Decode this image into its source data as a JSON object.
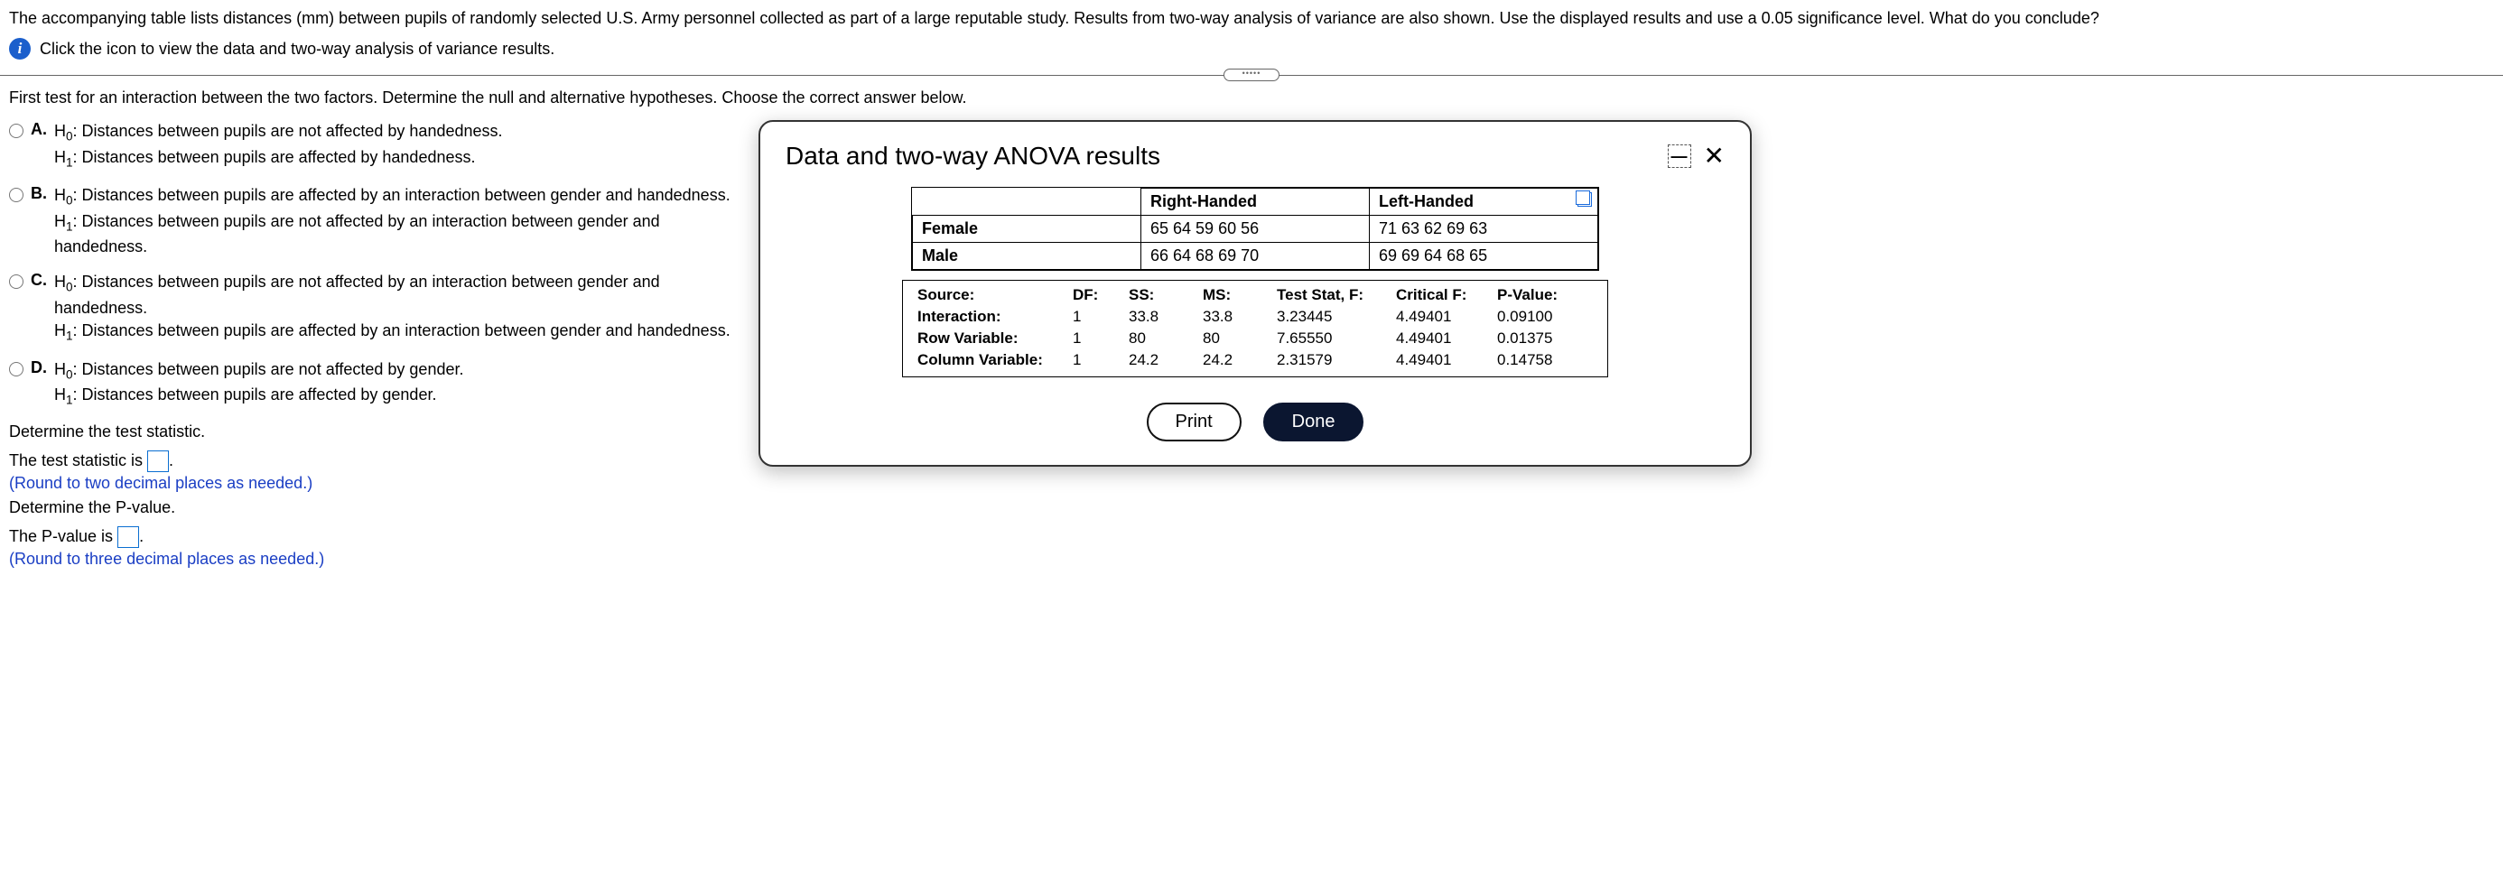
{
  "intro": "The accompanying table lists distances (mm) between pupils of randomly selected U.S. Army personnel collected as part of a large reputable study. Results from two-way analysis of variance are also shown. Use the displayed results and use a 0.05 significance level. What do you conclude?",
  "info_link": "Click the icon to view the data and two-way analysis of variance results.",
  "prompt": "First test for an interaction between the two factors. Determine the null and alternative hypotheses. Choose the correct answer below.",
  "options": {
    "a": {
      "letter": "A.",
      "h0": "Distances between pupils are not affected by handedness.",
      "h1": "Distances between pupils are affected by handedness."
    },
    "b": {
      "letter": "B.",
      "h0": "Distances between pupils are affected by an interaction between gender and handedness.",
      "h1": "Distances between pupils are not affected by an interaction between gender and handedness."
    },
    "c": {
      "letter": "C.",
      "h0": "Distances between pupils are not affected by an interaction between gender and handedness.",
      "h1": "Distances between pupils are affected by an interaction between gender and handedness."
    },
    "d": {
      "letter": "D.",
      "h0": "Distances between pupils are not affected by gender.",
      "h1": "Distances between pupils are affected by gender."
    }
  },
  "det_stat_label": "Determine the test statistic.",
  "ts_pre": "The test statistic is ",
  "ts_post": ".",
  "ts_hint": "(Round to two decimal places as needed.)",
  "det_p_label": "Determine the P-value.",
  "p_pre": "The P-value is ",
  "p_post": ".",
  "p_hint": "(Round to three decimal places as needed.)",
  "modal": {
    "title": "Data and two-way ANOVA results",
    "cols": {
      "rh": "Right-Handed",
      "lh": "Left-Handed"
    },
    "rows": {
      "female": {
        "label": "Female",
        "rh": "65 64 59 60 56",
        "lh": "71 63 62 69 63"
      },
      "male": {
        "label": "Male",
        "rh": "66 64 68 69 70",
        "lh": "69 69 64 68 65"
      }
    },
    "anova_headers": {
      "source": "Source:",
      "df": "DF:",
      "ss": "SS:",
      "ms": "MS:",
      "f": "Test Stat, F:",
      "crit": "Critical F:",
      "p": "P-Value:"
    },
    "anova": [
      {
        "source": "Interaction:",
        "df": "1",
        "ss": "33.8",
        "ms": "33.8",
        "f": "3.23445",
        "crit": "4.49401",
        "p": "0.09100"
      },
      {
        "source": "Row Variable:",
        "df": "1",
        "ss": "80",
        "ms": "80",
        "f": "7.65550",
        "crit": "4.49401",
        "p": "0.01375"
      },
      {
        "source": "Column Variable:",
        "df": "1",
        "ss": "24.2",
        "ms": "24.2",
        "f": "2.31579",
        "crit": "4.49401",
        "p": "0.14758"
      }
    ],
    "print": "Print",
    "done": "Done"
  },
  "chart_data": {
    "type": "table",
    "title": "Data and two-way ANOVA results",
    "raw_data": {
      "columns": [
        "Right-Handed",
        "Left-Handed"
      ],
      "rows": [
        {
          "label": "Female",
          "Right-Handed": [
            65,
            64,
            59,
            60,
            56
          ],
          "Left-Handed": [
            71,
            63,
            62,
            69,
            63
          ]
        },
        {
          "label": "Male",
          "Right-Handed": [
            66,
            64,
            68,
            69,
            70
          ],
          "Left-Handed": [
            69,
            69,
            64,
            68,
            65
          ]
        }
      ]
    },
    "anova": [
      {
        "Source": "Interaction",
        "DF": 1,
        "SS": 33.8,
        "MS": 33.8,
        "F": 3.23445,
        "CriticalF": 4.49401,
        "P": 0.091
      },
      {
        "Source": "Row Variable",
        "DF": 1,
        "SS": 80,
        "MS": 80,
        "F": 7.6555,
        "CriticalF": 4.49401,
        "P": 0.01375
      },
      {
        "Source": "Column Variable",
        "DF": 1,
        "SS": 24.2,
        "MS": 24.2,
        "F": 2.31579,
        "CriticalF": 4.49401,
        "P": 0.14758
      }
    ]
  }
}
